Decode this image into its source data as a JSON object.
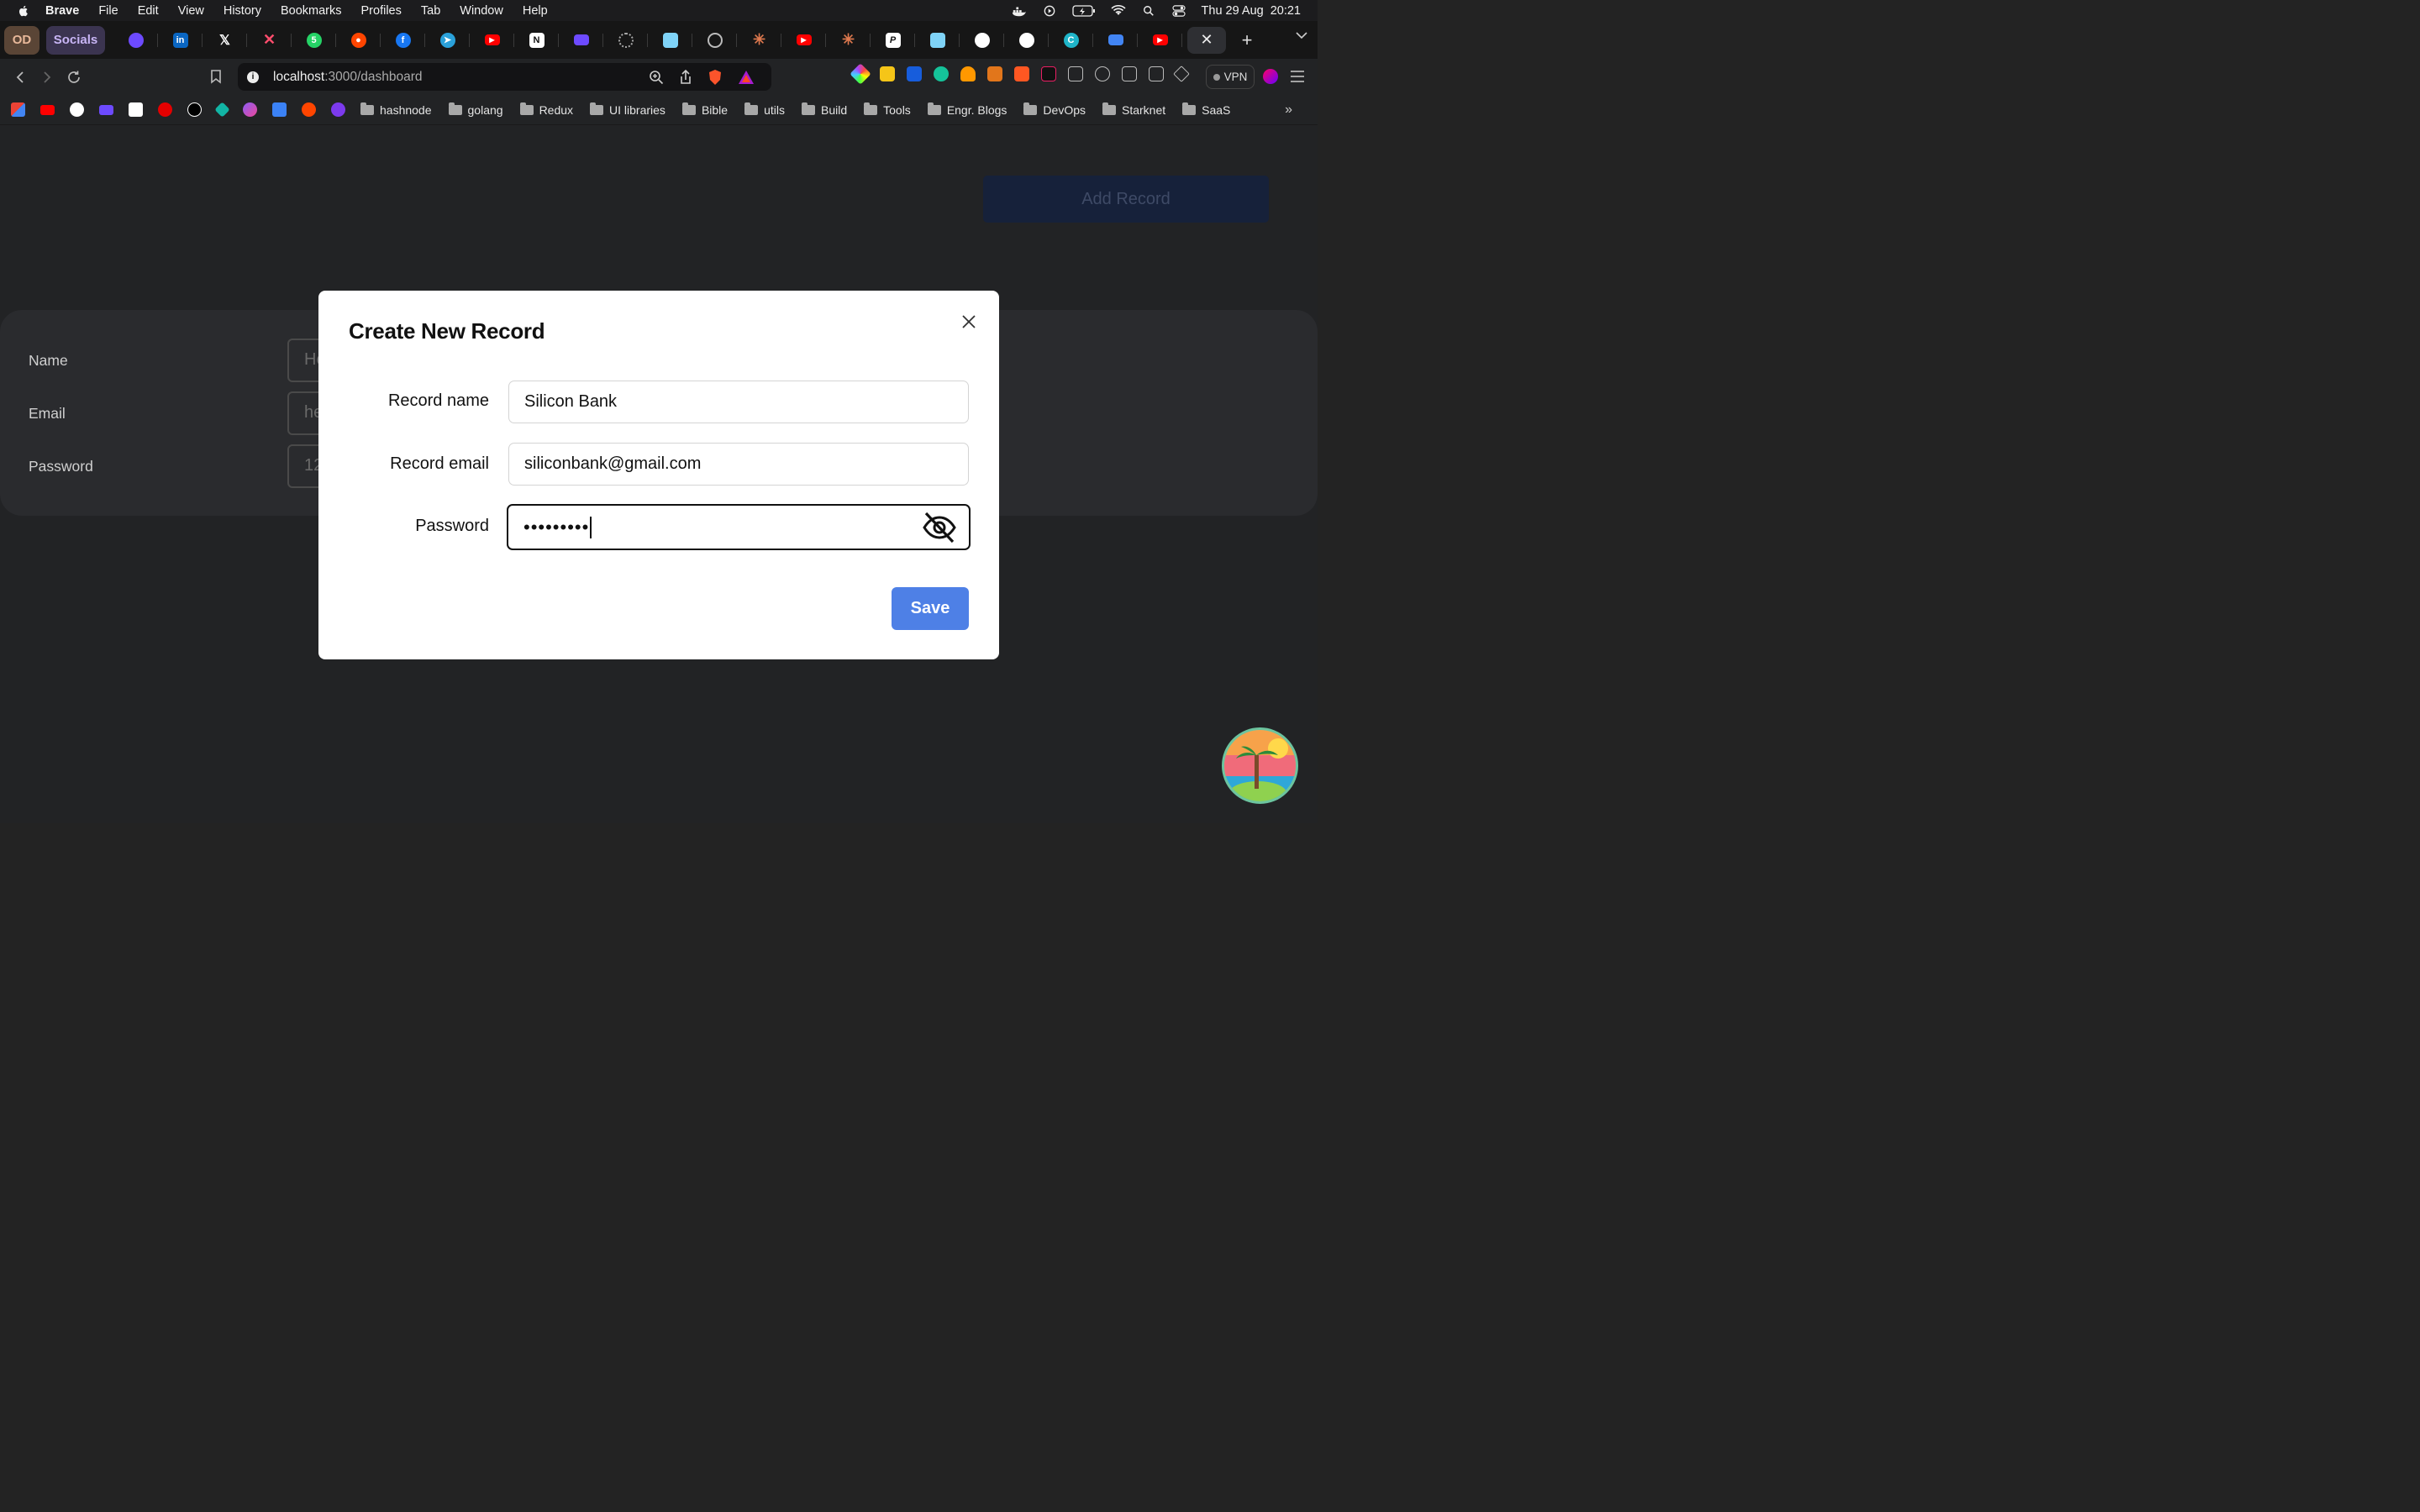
{
  "menubar": {
    "app": "Brave",
    "items": [
      "File",
      "Edit",
      "View",
      "History",
      "Bookmarks",
      "Profiles",
      "Tab",
      "Window",
      "Help"
    ],
    "date": "Thu 29 Aug",
    "time": "20:21"
  },
  "tabs": {
    "groups": [
      "OD",
      "Socials"
    ],
    "pinned_icons": [
      "proton-icon",
      "linkedin-icon",
      "x-icon",
      "notion-x-icon",
      "whatsapp-icon",
      "reddit-icon",
      "facebook-icon",
      "telegram-icon",
      "youtube-icon",
      "notion-icon",
      "proton-mail-icon",
      "loading-icon",
      "docs-icon",
      "openai-icon",
      "claude-icon",
      "youtube-icon",
      "claude-icon",
      "perplexity-icon",
      "docs-icon",
      "github-icon",
      "github-icon",
      "canva-icon",
      "meet-icon",
      "youtube-icon"
    ],
    "active_close": "✕",
    "new_tab": "+"
  },
  "toolbar": {
    "url_host": "localhost",
    "url_path": ":3000/dashboard",
    "vpn_label": "VPN"
  },
  "bookmarks": {
    "folders": [
      "hashnode",
      "golang",
      "Redux",
      "UI libraries",
      "Bible",
      "utils",
      "Build",
      "Tools",
      "Engr. Blogs",
      "DevOps",
      "Starknet",
      "SaaS"
    ],
    "more": "»"
  },
  "dashboard": {
    "add_record_label": "Add Record",
    "rows": [
      {
        "label": "Name",
        "value": "He"
      },
      {
        "label": "Email",
        "value": "he"
      },
      {
        "label": "Password",
        "value": "12"
      }
    ]
  },
  "modal": {
    "title": "Create New Record",
    "fields": {
      "name_label": "Record name",
      "name_value": "Silicon Bank",
      "email_label": "Record email",
      "email_value": "siliconbank@gmail.com",
      "password_label": "Password",
      "password_value": "•••••••••"
    },
    "save_label": "Save"
  }
}
